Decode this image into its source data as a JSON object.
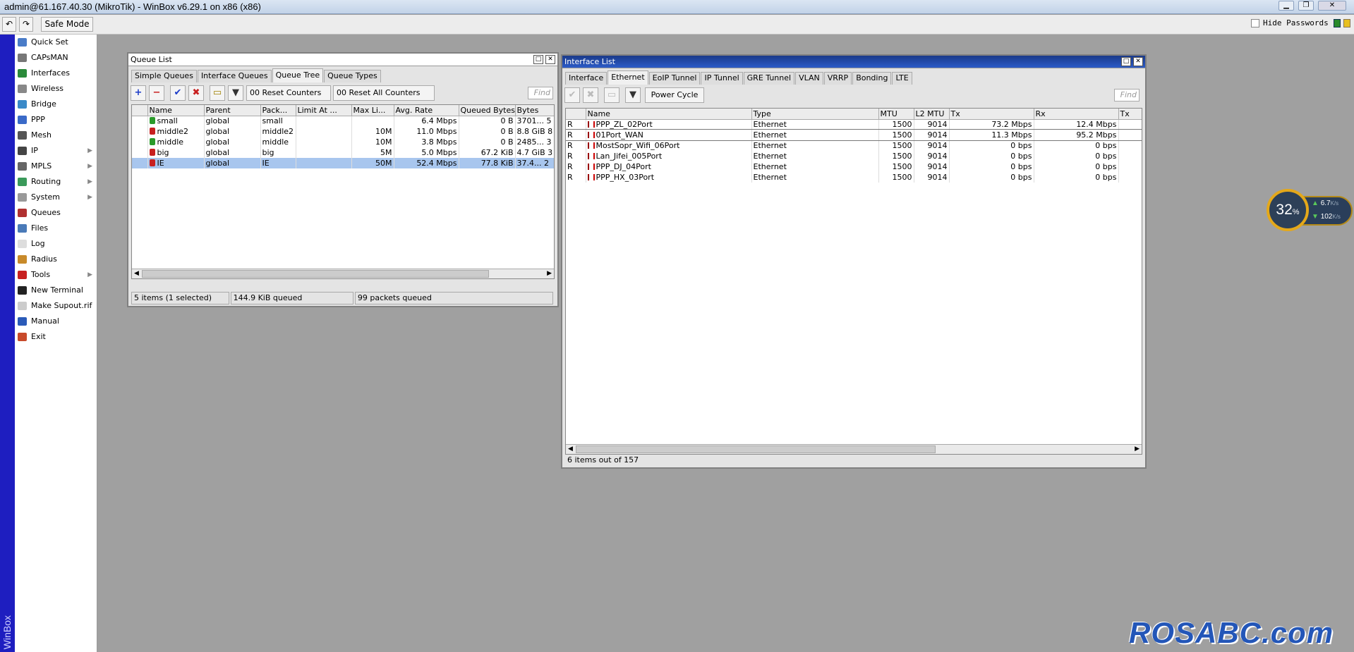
{
  "window": {
    "title": "admin@61.167.40.30 (MikroTik) - WinBox v6.29.1 on x86 (x86)"
  },
  "toolbar": {
    "safe_mode": "Safe Mode",
    "hide_passwords": "Hide Passwords"
  },
  "strip": {
    "label": "WinBox"
  },
  "sidebar": {
    "items": [
      {
        "label": "Quick Set",
        "icon": "quick-set-icon",
        "color": "#4a7cc8"
      },
      {
        "label": "CAPsMAN",
        "icon": "capsman-icon",
        "color": "#777777"
      },
      {
        "label": "Interfaces",
        "icon": "interfaces-icon",
        "color": "#2a8a3a"
      },
      {
        "label": "Wireless",
        "icon": "wireless-icon",
        "color": "#888888"
      },
      {
        "label": "Bridge",
        "icon": "bridge-icon",
        "color": "#3a8ac8"
      },
      {
        "label": "PPP",
        "icon": "ppp-icon",
        "color": "#3a6ac8"
      },
      {
        "label": "Mesh",
        "icon": "mesh-icon",
        "color": "#555555"
      },
      {
        "label": "IP",
        "icon": "ip-icon",
        "color": "#444444",
        "sub": "▶"
      },
      {
        "label": "MPLS",
        "icon": "mpls-icon",
        "color": "#666666",
        "sub": "▶"
      },
      {
        "label": "Routing",
        "icon": "routing-icon",
        "color": "#3a9a5a",
        "sub": "▶"
      },
      {
        "label": "System",
        "icon": "system-icon",
        "color": "#999999",
        "sub": "▶"
      },
      {
        "label": "Queues",
        "icon": "queues-icon",
        "color": "#b03030"
      },
      {
        "label": "Files",
        "icon": "files-icon",
        "color": "#4a7ab8"
      },
      {
        "label": "Log",
        "icon": "log-icon",
        "color": "#dddddd"
      },
      {
        "label": "Radius",
        "icon": "radius-icon",
        "color": "#c88a2a"
      },
      {
        "label": "Tools",
        "icon": "tools-icon",
        "color": "#c82020",
        "sub": "▶"
      },
      {
        "label": "New Terminal",
        "icon": "terminal-icon",
        "color": "#222222"
      },
      {
        "label": "Make Supout.rif",
        "icon": "supout-icon",
        "color": "#cccccc"
      },
      {
        "label": "Manual",
        "icon": "manual-icon",
        "color": "#2a5ab8"
      },
      {
        "label": "Exit",
        "icon": "exit-icon",
        "color": "#c84a2a"
      }
    ]
  },
  "queue": {
    "title": "Queue List",
    "tabs": [
      "Simple Queues",
      "Interface Queues",
      "Queue Tree",
      "Queue Types"
    ],
    "selected_tab": 2,
    "reset_counters": "00 Reset Counters",
    "reset_all": "00 Reset All Counters",
    "find": "Find",
    "columns": [
      "Name",
      "Parent",
      "Pack...",
      "Limit At ...",
      "Max Li...",
      "Avg. Rate",
      "Queued Bytes",
      "Bytes"
    ],
    "rows": [
      {
        "name": "small",
        "parent": "global",
        "packet": "small",
        "limit": "",
        "max": "",
        "avg": "6.4 Mbps",
        "queued": "0 B",
        "bytes": "3701... 5",
        "color": "#2a9a2a",
        "selected": false
      },
      {
        "name": "middle2",
        "parent": "global",
        "packet": "middle2",
        "limit": "",
        "max": "10M",
        "avg": "11.0 Mbps",
        "queued": "0 B",
        "bytes": "8.8 GiB 8",
        "color": "#c82020",
        "selected": false
      },
      {
        "name": "middle",
        "parent": "global",
        "packet": "middle",
        "limit": "",
        "max": "10M",
        "avg": "3.8 Mbps",
        "queued": "0 B",
        "bytes": "2485... 3",
        "color": "#2a9a2a",
        "selected": false
      },
      {
        "name": "big",
        "parent": "global",
        "packet": "big",
        "limit": "",
        "max": "5M",
        "avg": "5.0 Mbps",
        "queued": "67.2 KiB",
        "bytes": "4.7 GiB 3",
        "color": "#c82020",
        "selected": false
      },
      {
        "name": "IE",
        "parent": "global",
        "packet": "IE",
        "limit": "",
        "max": "50M",
        "avg": "52.4 Mbps",
        "queued": "77.8 KiB",
        "bytes": "37.4... 2",
        "color": "#c82020",
        "selected": true
      }
    ],
    "status": [
      "5 items (1 selected)",
      "144.9 KiB queued",
      "99 packets queued"
    ]
  },
  "iface": {
    "title": "Interface List",
    "tabs": [
      "Interface",
      "Ethernet",
      "EoIP Tunnel",
      "IP Tunnel",
      "GRE Tunnel",
      "VLAN",
      "VRRP",
      "Bonding",
      "LTE"
    ],
    "selected_tab": 1,
    "power_cycle": "Power Cycle",
    "find": "Find",
    "columns": [
      "Name",
      "Type",
      "MTU",
      "L2 MTU",
      "Tx",
      "Rx",
      "Tx"
    ],
    "rows": [
      {
        "flag": "R",
        "name": "PPP_ZL_02Port",
        "type": "Ethernet",
        "mtu": "1500",
        "l2mtu": "9014",
        "tx": "73.2 Mbps",
        "rx": "12.4 Mbps"
      },
      {
        "flag": "R",
        "name": "01Port_WAN",
        "type": "Ethernet",
        "mtu": "1500",
        "l2mtu": "9014",
        "tx": "11.3 Mbps",
        "rx": "95.2 Mbps"
      },
      {
        "flag": "R",
        "name": "MostSopr_Wifi_06Port",
        "type": "Ethernet",
        "mtu": "1500",
        "l2mtu": "9014",
        "tx": "0 bps",
        "rx": "0 bps"
      },
      {
        "flag": "R",
        "name": "Lan_Jifei_005Port",
        "type": "Ethernet",
        "mtu": "1500",
        "l2mtu": "9014",
        "tx": "0 bps",
        "rx": "0 bps"
      },
      {
        "flag": "R",
        "name": "PPP_DJ_04Port",
        "type": "Ethernet",
        "mtu": "1500",
        "l2mtu": "9014",
        "tx": "0 bps",
        "rx": "0 bps"
      },
      {
        "flag": "R",
        "name": "PPP_HX_03Port",
        "type": "Ethernet",
        "mtu": "1500",
        "l2mtu": "9014",
        "tx": "0 bps",
        "rx": "0 bps"
      }
    ],
    "status": "6 items out of 157"
  },
  "netmon": {
    "percent": "32",
    "pct_sign": "%",
    "up": "6.7",
    "down": "102",
    "unit": "K/s"
  },
  "watermark": "ROSABC.com"
}
